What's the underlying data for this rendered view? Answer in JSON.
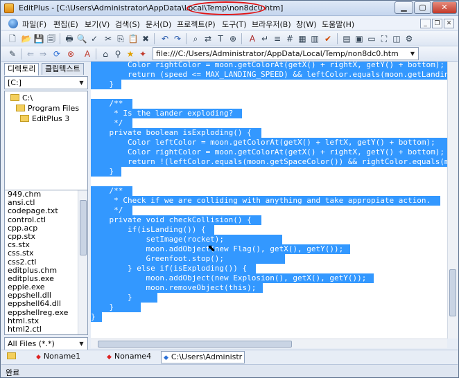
{
  "window": {
    "title": "EditPlus - [C:\\Users\\Administrator\\AppData\\Local\\Temp\\non8dc0.htm]"
  },
  "menu": {
    "items": [
      "파일(F)",
      "편집(E)",
      "보기(V)",
      "검색(S)",
      "문서(D)",
      "프로젝트(P)",
      "도구(T)",
      "브라우저(B)",
      "창(W)",
      "도움말(H)"
    ]
  },
  "toolbar": {
    "url": "file:///C:/Users/Administrator/AppData/Local/Temp/non8dc0.htm"
  },
  "sidebar": {
    "tabs": [
      "디렉토리",
      "클립텍스트"
    ],
    "drive": "[C:]",
    "folders": [
      "C:\\",
      "Program Files",
      "EditPlus 3"
    ],
    "files": [
      "949.chm",
      "ansi.ctl",
      "codepage.txt",
      "control.ctl",
      "cpp.acp",
      "cpp.stx",
      "cs.stx",
      "css.stx",
      "css2.ctl",
      "editplus.chm",
      "editplus.exe",
      "eppie.exe",
      "eppshell.dll",
      "eppshell64.dll",
      "eppshellreg.exe",
      "html.stx",
      "html2.ctl"
    ],
    "filter": "All Files (*.*)"
  },
  "editor": {
    "lines": [
      "        Color rightColor = moon.getColorAt(getX() + rightX, getY() + bottom);",
      "        return (speed <= MAX_LANDING_SPEED) && leftColor.equals(moon.getLandingColor()",
      "    }",
      "",
      "    /**",
      "     * Is the lander exploding?",
      "     */",
      "    private boolean isExploding() {",
      "        Color leftColor = moon.getColorAt(getX() + leftX, getY() + bottom);",
      "        Color rightColor = moon.getColorAt(getX() + rightX, getY() + bottom);",
      "        return !(leftColor.equals(moon.getSpaceColor()) && rightColor.equals(moon.g",
      "    }",
      "",
      "    /**",
      "     * Check if we are colliding with anything and take appropiate action.",
      "     */",
      "    private void checkCollision() {",
      "        if(isLanding()) {",
      "            setImage(rocket);",
      "            moon.addObject(new Flag(), getX(), getY());",
      "            Greenfoot.stop();",
      "        } else if(isExploding()) {",
      "            moon.addObject(new Explosion(), getX(), getY());",
      "            moon.removeObject(this);",
      "        }",
      "    }",
      "}"
    ]
  },
  "doctabs": [
    "Noname1",
    "Noname4",
    "C:\\Users\\Administr"
  ],
  "status": {
    "text": "완료"
  }
}
